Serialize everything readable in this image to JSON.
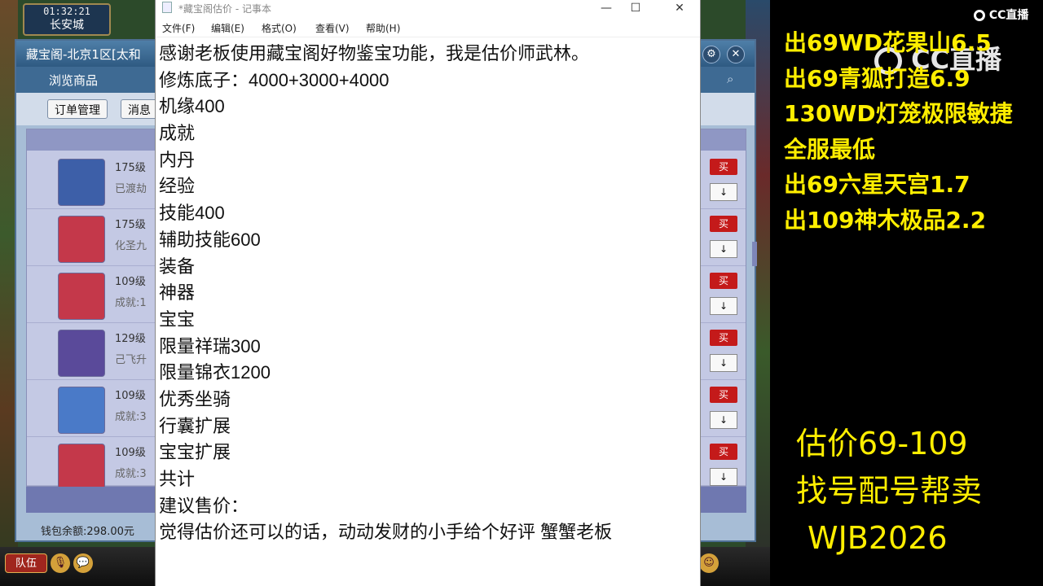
{
  "game": {
    "clock_time": "01:32:21",
    "clock_city": "长安城",
    "shop": {
      "title": "藏宝阁-北京1区[太和",
      "nav_label": "浏览商品",
      "buttons": [
        "订单管理",
        "消息"
      ],
      "settings_label": "设置",
      "settings_icon": "gear-icon",
      "close_icon": "close-icon",
      "search_icon": "search-icon",
      "rows": [
        {
          "level": "175级",
          "sub": "已渡劫",
          "avatar_color": "#3d5fa8"
        },
        {
          "level": "175级",
          "sub": "化圣九",
          "avatar_color": "#c4384a"
        },
        {
          "level": "109级",
          "sub": "成就:1",
          "avatar_color": "#c4384a"
        },
        {
          "level": "129级",
          "sub": "己飞升",
          "avatar_color": "#5a4a9a"
        },
        {
          "level": "109级",
          "sub": "成就:3",
          "avatar_color": "#4a7ac8"
        },
        {
          "level": "109级",
          "sub": "成就:3",
          "avatar_color": "#c4384a"
        }
      ],
      "buy_label": "买",
      "sort_label": "↓",
      "wallet": "钱包余额:298.00元"
    },
    "taskbar": {
      "team_label": "队伍"
    }
  },
  "notepad": {
    "title": "*藏宝阁估价 - 记事本",
    "menu": [
      "文件(F)",
      "编辑(E)",
      "格式(O)",
      "查看(V)",
      "帮助(H)"
    ],
    "window_controls": [
      "—",
      "☐",
      "✕"
    ],
    "lines": [
      "感谢老板使用藏宝阁好物鉴宝功能，我是估价师武林。",
      "修炼底子：4000+3000+4000",
      "机缘400",
      "成就",
      "内丹",
      "经验",
      "技能400",
      "辅助技能600",
      "装备",
      "神器",
      "宝宝",
      "限量祥瑞300",
      "限量锦衣1200",
      "优秀坐骑",
      "行囊扩展",
      "宝宝扩展",
      "共计",
      "建议售价：",
      "觉得估价还可以的话，动动发财的小手给个好评 蟹蟹老板"
    ]
  },
  "overlay": {
    "cc_logo_small": "CC直播",
    "cc_logo_big": "CC直播",
    "ads": [
      "出69WD花果山6.5",
      "出69青狐打造6.9",
      "130WD灯笼极限敏捷",
      "全服最低",
      "出69六星天宫1.7",
      "出109神木极品2.2"
    ],
    "price_lines": [
      "估价69-109",
      "找号配号帮卖",
      "WJB2026"
    ],
    "accent_color": "#ffee00"
  }
}
